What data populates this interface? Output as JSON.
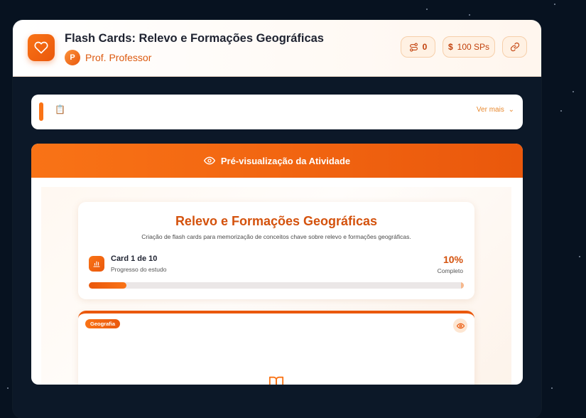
{
  "header": {
    "title": "Flash Cards: Relevo e Formações Geográficas",
    "author_initial": "P",
    "author_name": "Prof. Professor",
    "connections_count": "0",
    "sp_label": "100 SPs",
    "sp_symbol": "$"
  },
  "description": {
    "icon": "clipboard-icon",
    "see_more": "Ver mais"
  },
  "preview": {
    "header_label": "Pré-visualização da Atividade",
    "title": "Relevo e Formações Geográficas",
    "subtitle": "Criação de flash cards para memorização de conceitos chave sobre relevo e formações geográficas.",
    "card_counter": "Card 1 de 10",
    "progress_label": "Progresso do estudo",
    "progress_percent_text": "10%",
    "progress_value": 0.1,
    "complete_label": "Completo",
    "card_tag": "Geografia"
  },
  "colors": {
    "accent": "#f97316",
    "accent_dark": "#ea580c",
    "background": "#071220"
  }
}
